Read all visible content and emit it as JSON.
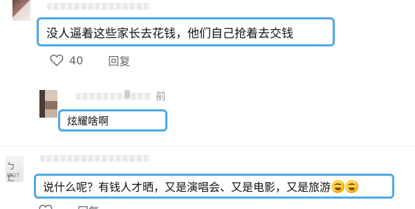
{
  "comments": [
    {
      "text": "没人逼着这些家长去花钱，他们自己抢着去交钱",
      "likes": "40",
      "reply_label": "回复"
    },
    {
      "time_suffix": "前",
      "text": "炫耀啥啊"
    },
    {
      "avatar_text": "ㄅ亡ゃ",
      "avatar_sub": "NCIT",
      "text": "说什么呢？有钱人才晒，又是演唱会、又是电影，又是旅游",
      "emojis": [
        "laughing-crying-emoji",
        "laughing-crying-emoji"
      ],
      "reply_label": "回复"
    }
  ],
  "colors": {
    "highlight_border": "#4aa8e6",
    "meta_text": "#666666"
  }
}
